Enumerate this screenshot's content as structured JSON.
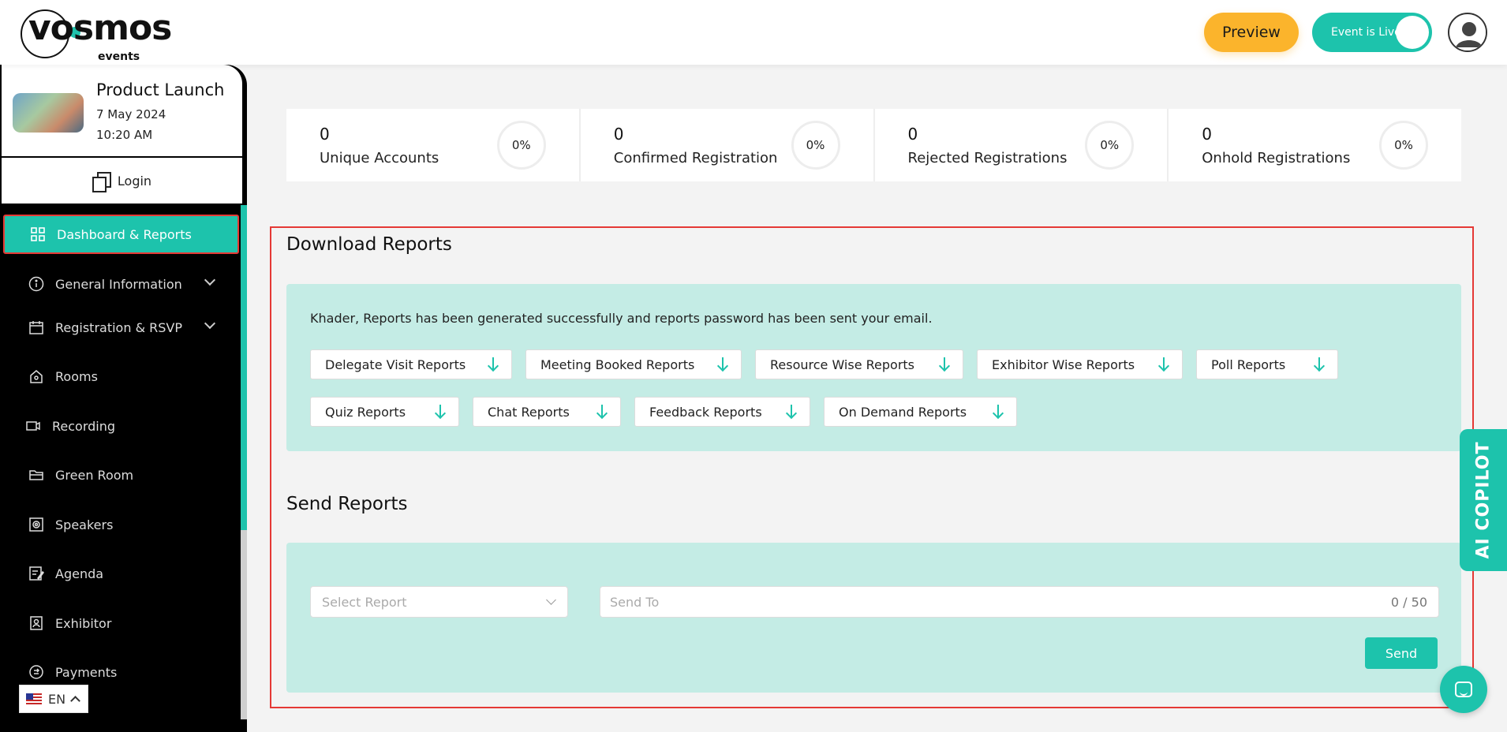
{
  "brand": {
    "logo_text": "vosmos",
    "logo_sub": "events",
    "accent": "#1dc3ac",
    "preview_color": "#fbb42c"
  },
  "header": {
    "preview_label": "Preview",
    "live_label": "Event is Live"
  },
  "event": {
    "title": "Product Launch",
    "date": "7 May 2024",
    "time": "10:20 AM",
    "login_label": "Login"
  },
  "sidebar": {
    "items": [
      {
        "label": "Dashboard & Reports",
        "icon": "grid-icon"
      },
      {
        "label": "General Information",
        "icon": "info-icon"
      },
      {
        "label": "Registration & RSVP",
        "icon": "calendar-icon"
      },
      {
        "label": "Rooms",
        "icon": "home-icon"
      },
      {
        "label": "Recording",
        "icon": "video-icon"
      },
      {
        "label": "Green Room",
        "icon": "folder-icon"
      },
      {
        "label": "Speakers",
        "icon": "speaker-icon"
      },
      {
        "label": "Agenda",
        "icon": "edit-icon"
      },
      {
        "label": "Exhibitor",
        "icon": "badge-icon"
      },
      {
        "label": "Payments",
        "icon": "payment-icon"
      }
    ]
  },
  "language": {
    "code": "EN"
  },
  "stats": [
    {
      "value": "0",
      "label": "Unique Accounts",
      "percent": "0%"
    },
    {
      "value": "0",
      "label": "Confirmed Registration",
      "percent": "0%"
    },
    {
      "value": "0",
      "label": "Rejected Registrations",
      "percent": "0%"
    },
    {
      "value": "0",
      "label": "Onhold Registrations",
      "percent": "0%"
    }
  ],
  "download": {
    "title": "Download Reports",
    "message": "Khader, Reports has been generated successfully and reports password has been sent your email.",
    "reports": [
      "Delegate Visit Reports",
      "Meeting Booked Reports",
      "Resource Wise Reports",
      "Exhibitor Wise Reports",
      "Poll Reports",
      "Quiz Reports",
      "Chat Reports",
      "Feedback Reports",
      "On Demand Reports"
    ]
  },
  "send": {
    "title": "Send Reports",
    "select_placeholder": "Select Report",
    "sendto_placeholder": "Send To",
    "counter": "0 / 50",
    "send_label": "Send"
  },
  "copilot": {
    "label": "AI COPILOT"
  }
}
